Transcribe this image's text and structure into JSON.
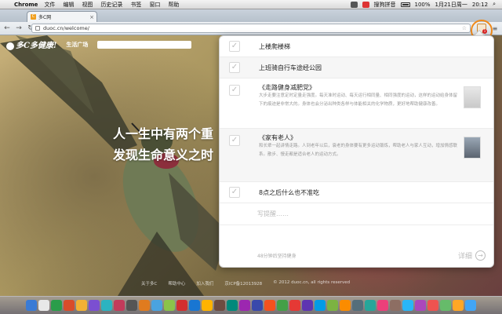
{
  "menubar": {
    "app_name": "Chrome",
    "menus": [
      "文件",
      "编辑",
      "视图",
      "历史记录",
      "书签",
      "窗口",
      "帮助"
    ],
    "status_text": "搜狗拼音",
    "battery": "100%",
    "date": "1月21日周一",
    "time": "20:12"
  },
  "browser": {
    "tab_title": "多C网",
    "tab_favicon": "C",
    "url": "duoc.cn/welcome/"
  },
  "site": {
    "logo_text": "多C多健康!",
    "nav_link": "生活广场",
    "hero_line1": "人一生中有两个重",
    "hero_line2": "发现生命意义之时",
    "footer_links": [
      "关于多C",
      "帮助中心",
      "加入我们",
      "京ICP备12013928",
      "© 2012 duoc.cn, all rights reserved"
    ]
  },
  "popup": {
    "items": [
      {
        "title": "上楼爬楼梯",
        "type": "short"
      },
      {
        "title": "上班骑自行车途经公园",
        "type": "short"
      },
      {
        "title": "《走路健身减肥党》",
        "type": "tall",
        "snippet": "大步走要注意定时定量走强度。每天准时运动、每天运行相同量、相同强度的运动，这样的运动给身体留下的痕迹是非常大的。身体也会分泌出种类各样与体能相关的化学物质，更好地帮助健康改善。"
      },
      {
        "title": "《家有老人》",
        "type": "tall",
        "snippet": "和长辈一起讲情走路。人到老年以后，衰老的身体要有更多运动锻炼，帮助老人与家人互动，增加情感联系。散步、慢走都是适合老人的运动方式。"
      },
      {
        "title": "8点之后什么也不准吃",
        "type": "short"
      }
    ],
    "write_placeholder": "写提醒……",
    "status_text": "48分钟后坚持健身",
    "detail_label": "详细"
  },
  "colors": {
    "highlight_ring": "#f08a1a",
    "popup_bg": "#ffffff"
  }
}
